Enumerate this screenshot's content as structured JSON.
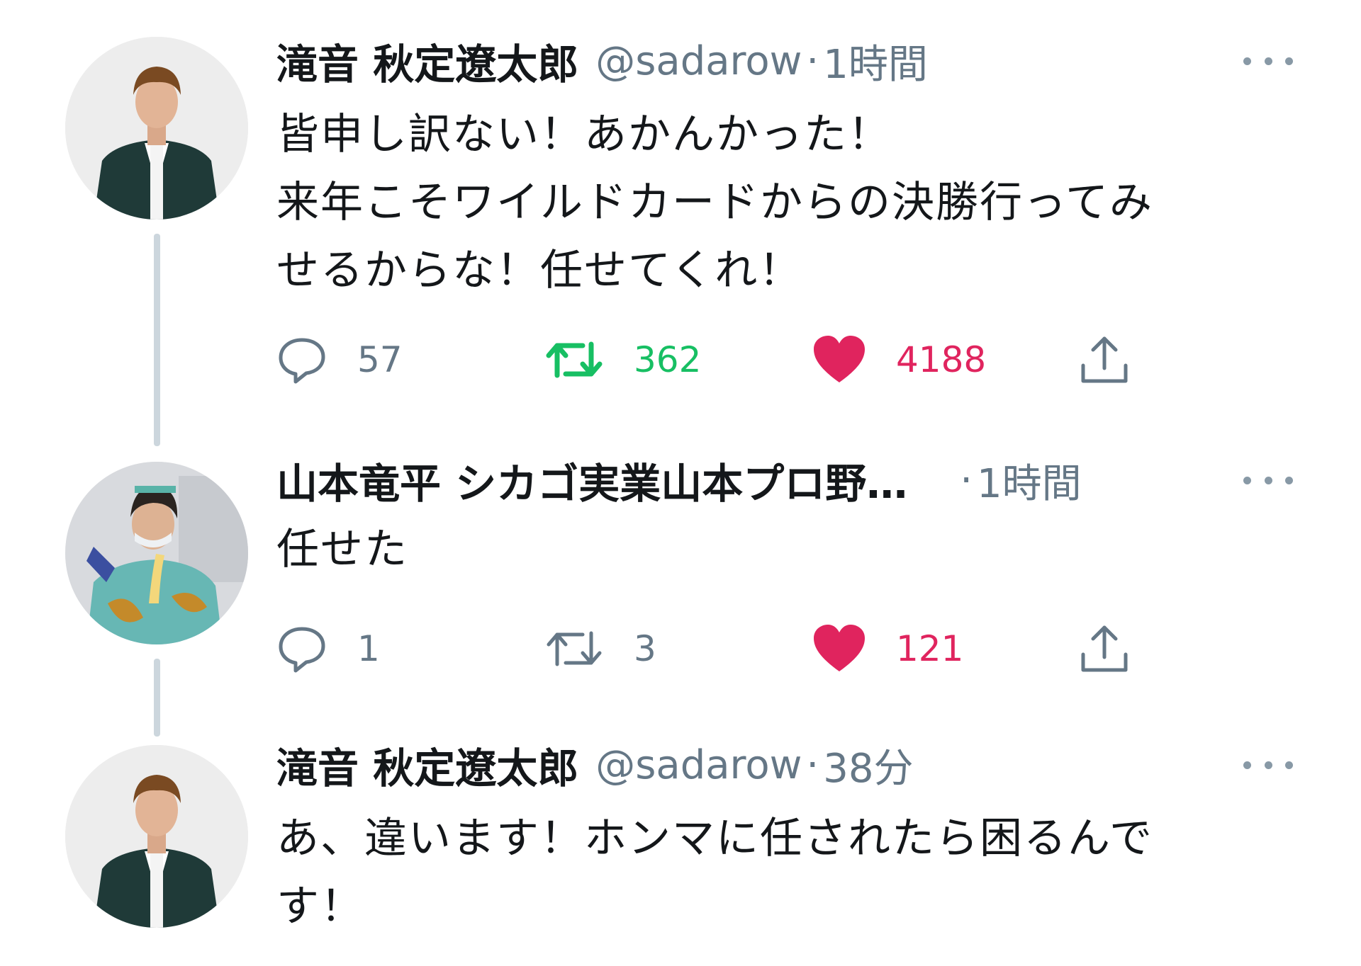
{
  "colors": {
    "text": "#14171a",
    "muted": "#657786",
    "retweet_green": "#17bf63",
    "like_red": "#e0245e",
    "thread_line": "#ccd6dd"
  },
  "icons": {
    "reply": "reply-icon",
    "retweet": "retweet-icon",
    "like": "heart-icon",
    "share": "share-icon",
    "more": "more-options-icon"
  },
  "tweets": [
    {
      "display_name": "滝音 秋定遼太郎",
      "handle": "@sadarow",
      "dot": "·",
      "time": "1時間",
      "text": "皆申し訳ない！あかんかった！\n来年こそワイルドカードからの決勝行ってみ\nせるからな！任せてくれ！",
      "replies": "57",
      "retweets": "362",
      "likes": "4188",
      "retweeted": true,
      "liked": true
    },
    {
      "display_name": "山本竜平 シカゴ実業山本プロ野…",
      "handle": "",
      "dot": "·",
      "time": "1時間",
      "text": "任せた",
      "replies": "1",
      "retweets": "3",
      "likes": "121",
      "retweeted": false,
      "liked": true
    },
    {
      "display_name": "滝音 秋定遼太郎",
      "handle": "@sadarow",
      "dot": "·",
      "time": "38分",
      "text": "あ、違います！ホンマに任されたら困るんで\nす！"
    }
  ]
}
